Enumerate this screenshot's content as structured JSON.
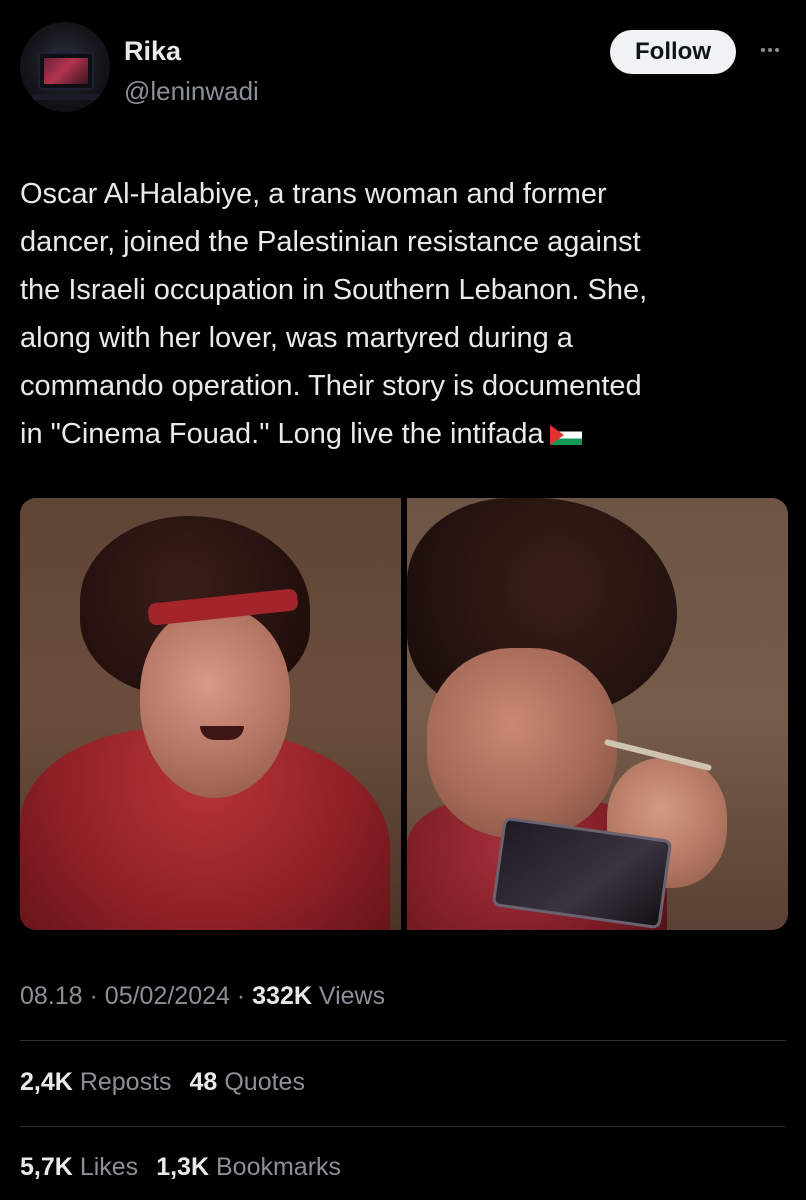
{
  "author": {
    "display_name": "Rika",
    "handle": "@leninwadi",
    "avatar_icon": "avatar-tv-image"
  },
  "actions": {
    "follow_label": "Follow",
    "more_icon": "more-horizontal-icon"
  },
  "tweet": {
    "lines": [
      "Oscar Al-Halabiye, a trans woman and former",
      "dancer, joined the Palestinian resistance against",
      "the Israeli occupation in Southern Lebanon. She,",
      "along with her lover, was martyred during a",
      "commando operation. Their story is documented",
      "in \"Cinema Fouad.\" Long live the intifada"
    ],
    "emoji_icon": "palestine-flag-icon"
  },
  "media": {
    "photo_count": 2
  },
  "meta": {
    "time": "08.18",
    "date": "05/02/2024",
    "views_count": "332K",
    "views_label": "Views",
    "separator": "·"
  },
  "stats": {
    "reposts_count": "2,4K",
    "reposts_label": "Reposts",
    "quotes_count": "48",
    "quotes_label": "Quotes",
    "likes_count": "5,7K",
    "likes_label": "Likes",
    "bookmarks_count": "1,3K",
    "bookmarks_label": "Bookmarks"
  },
  "colors": {
    "background": "#000000",
    "text_primary": "#e7e9ea",
    "text_secondary": "#8b9096",
    "divider": "#2f3336",
    "follow_bg": "#eff3f4"
  }
}
